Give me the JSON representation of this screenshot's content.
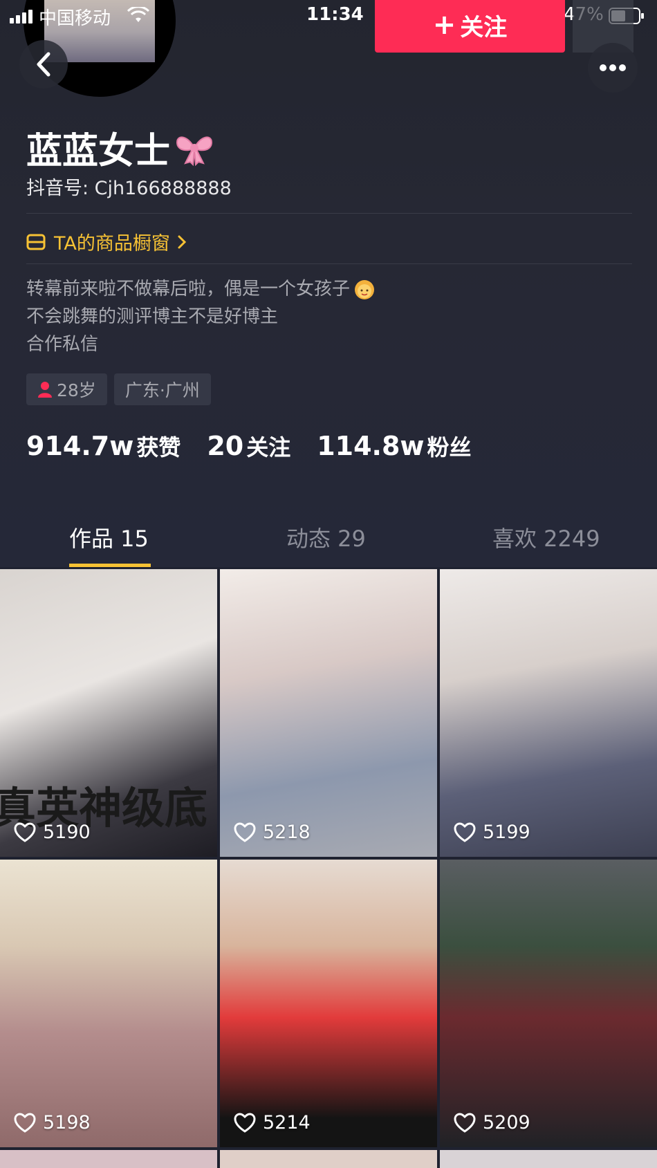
{
  "status_bar": {
    "carrier": "中国移动",
    "time": "11:34",
    "battery": "47%"
  },
  "header": {
    "follow_label": "关注",
    "nickname": "蓝蓝女士",
    "douyin_id": "抖音号: Cjh166888888",
    "shop_link": "TA的商品橱窗"
  },
  "bio": {
    "lines": [
      "转幕前来啦不做幕后啦，偶是一个女孩子",
      "不会跳舞的测评博主不是好博主",
      "合作私信"
    ]
  },
  "tags": [
    {
      "label": "28岁"
    },
    {
      "label": "广东·广州"
    }
  ],
  "stats": [
    {
      "value": "914.7w",
      "label": "获赞"
    },
    {
      "value": "20",
      "label": "关注"
    },
    {
      "value": "114.8w",
      "label": "粉丝"
    }
  ],
  "tabs": [
    {
      "label": "作品 15",
      "active": true
    },
    {
      "label": "动态 29",
      "active": false
    },
    {
      "label": "喜欢 2249",
      "active": false
    }
  ],
  "videos": [
    {
      "likes": "5190",
      "overlay": "真英神级底"
    },
    {
      "likes": "5218"
    },
    {
      "likes": "5199"
    },
    {
      "likes": "5198"
    },
    {
      "likes": "5214"
    },
    {
      "likes": "5209"
    }
  ],
  "colors": {
    "accent_red": "#fe2c55",
    "accent_yellow": "#f7c234",
    "background": "#1f2230"
  }
}
